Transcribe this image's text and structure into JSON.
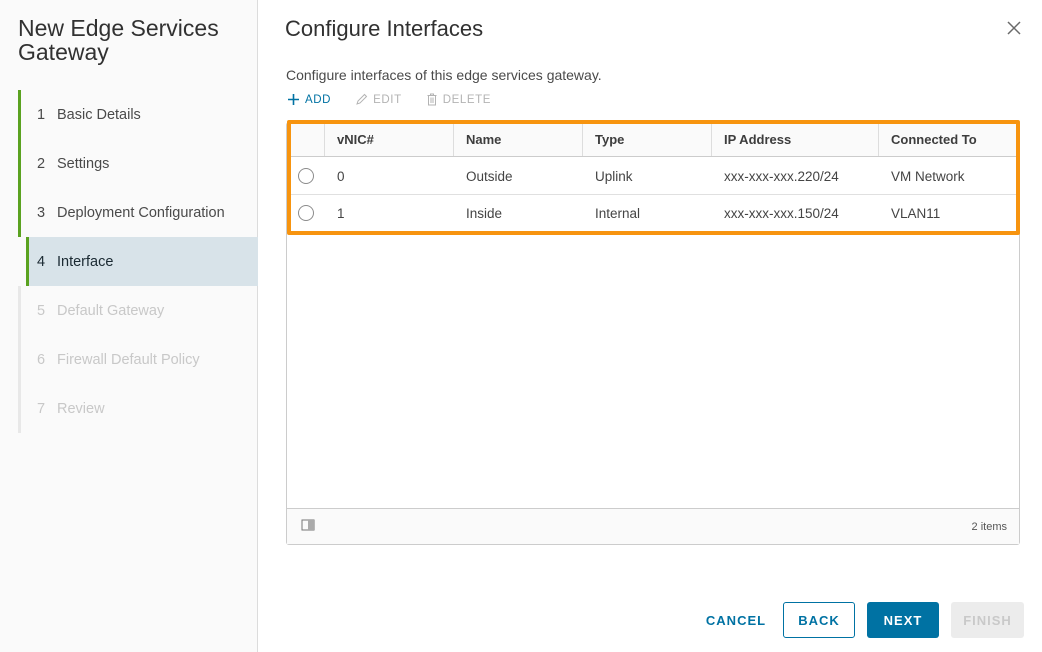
{
  "wizard": {
    "title": "New Edge Services Gateway",
    "steps": [
      {
        "num": "1",
        "label": "Basic Details",
        "state": "done"
      },
      {
        "num": "2",
        "label": "Settings",
        "state": "done"
      },
      {
        "num": "3",
        "label": "Deployment Configuration",
        "state": "done"
      },
      {
        "num": "4",
        "label": "Interface",
        "state": "current"
      },
      {
        "num": "5",
        "label": "Default Gateway",
        "state": "future"
      },
      {
        "num": "6",
        "label": "Firewall Default Policy",
        "state": "future"
      },
      {
        "num": "7",
        "label": "Review",
        "state": "future"
      }
    ]
  },
  "main": {
    "title": "Configure Interfaces",
    "description": "Configure interfaces of this edge services gateway.",
    "actions": {
      "add": "ADD",
      "edit": "EDIT",
      "delete": "DELETE"
    }
  },
  "grid": {
    "columns": [
      "vNIC#",
      "Name",
      "Type",
      "IP Address",
      "Connected To"
    ],
    "rows": [
      {
        "vnic": "0",
        "name": "Outside",
        "type": "Uplink",
        "ip": "xxx-xxx-xxx.220/24",
        "connected": "VM Network"
      },
      {
        "vnic": "1",
        "name": "Inside",
        "type": "Internal",
        "ip": "xxx-xxx-xxx.150/24",
        "connected": "VLAN11"
      }
    ],
    "footer_count": "2 items"
  },
  "buttons": {
    "cancel": "CANCEL",
    "back": "BACK",
    "next": "NEXT",
    "finish": "FINISH"
  },
  "colors": {
    "accent": "#0072a3",
    "step_done": "#5aa220",
    "highlight": "#f7940f",
    "current_step_bg": "#d8e3e9"
  }
}
